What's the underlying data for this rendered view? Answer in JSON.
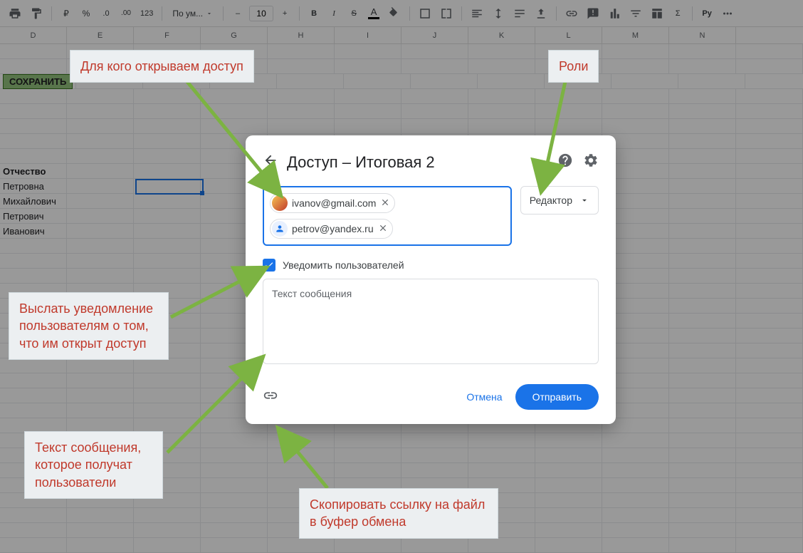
{
  "toolbar": {
    "style_select": "По ум...",
    "font_size": "10"
  },
  "columns": [
    "D",
    "E",
    "F",
    "G",
    "H",
    "I",
    "J",
    "K",
    "L",
    "M",
    "N"
  ],
  "sheet": {
    "save_button": "СОХРАНИТЬ",
    "header_col": "Отчество",
    "rows": [
      "Петровна",
      "Михайлович",
      "Петрович",
      "Иванович"
    ]
  },
  "dialog": {
    "title": "Доступ – Итоговая 2",
    "chips": [
      {
        "email": "ivanov@gmail.com",
        "avatar": "av1"
      },
      {
        "email": "petrov@yandex.ru",
        "avatar": "av2"
      }
    ],
    "role": "Редактор",
    "notify_label": "Уведомить пользователей",
    "message_placeholder": "Текст сообщения",
    "cancel": "Отмена",
    "send": "Отправить"
  },
  "annotations": {
    "a1": "Для кого открываем доступ",
    "a2": "Роли",
    "a3": "Выслать уведомление пользователям о том, что им открыт доступ",
    "a4": "Текст сообщения, которое получат пользователи",
    "a5": "Скопировать ссылку на файл в буфер обмена"
  }
}
